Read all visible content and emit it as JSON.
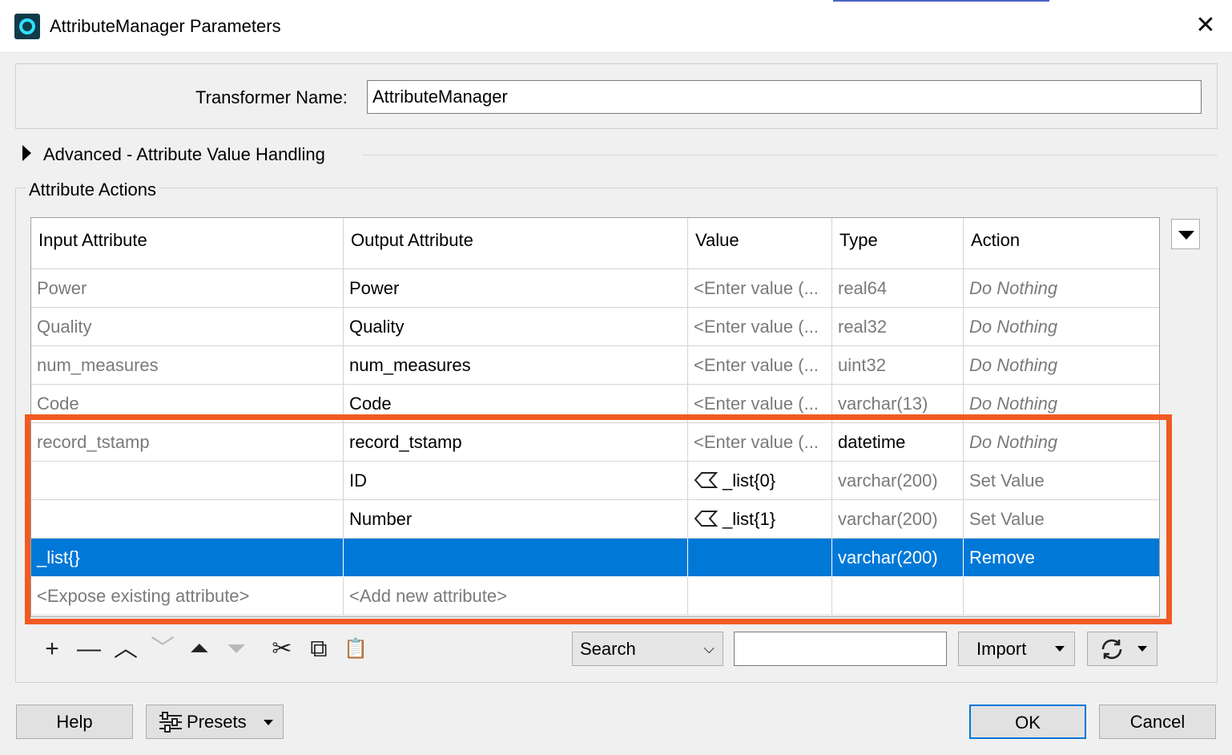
{
  "window": {
    "title": "AttributeManager Parameters",
    "close": "✕"
  },
  "transformer": {
    "label": "Transformer Name:",
    "value": "AttributeManager"
  },
  "advanced": {
    "label": "Advanced - Attribute Value Handling"
  },
  "actions": {
    "title": "Attribute Actions",
    "columns": [
      "Input Attribute",
      "Output Attribute",
      "Value",
      "Type",
      "Action"
    ],
    "rows": [
      {
        "input": "Power",
        "output": "Power",
        "value": "<Enter value (...",
        "type": "real64",
        "action": "Do Nothing"
      },
      {
        "input": "Quality",
        "output": "Quality",
        "value": "<Enter value (...",
        "type": "real32",
        "action": "Do Nothing"
      },
      {
        "input": "num_measures",
        "output": "num_measures",
        "value": "<Enter value (...",
        "type": "uint32",
        "action": "Do Nothing"
      },
      {
        "input": "Code",
        "output": "Code",
        "value": "<Enter value (...",
        "type": "varchar(13)",
        "action": "Do Nothing"
      },
      {
        "input": "record_tstamp",
        "output": "record_tstamp",
        "value": "<Enter value (...",
        "type": "datetime",
        "action": "Do Nothing"
      },
      {
        "input": "",
        "output": "ID",
        "value": "_list{0}",
        "type": "varchar(200)",
        "action": "Set Value"
      },
      {
        "input": "",
        "output": "Number",
        "value": "_list{1}",
        "type": "varchar(200)",
        "action": "Set Value"
      },
      {
        "input": "_list{}",
        "output": "",
        "value": "",
        "type": "varchar(200)",
        "action": "Remove"
      },
      {
        "input": "<Expose existing attribute>",
        "output": "<Add new attribute>",
        "value": "",
        "type": "",
        "action": ""
      }
    ],
    "selected_row": 7
  },
  "toolbar": {
    "add": "+",
    "remove": "—",
    "move_up": "︿",
    "move_down": "﹀",
    "move_top": "⏶",
    "move_bottom": "⏷",
    "cut": "✂",
    "copy": "⧉",
    "paste": "📋",
    "search_select": "Search",
    "search_chevron": "⌵",
    "search_value": "",
    "import_label": "Import"
  },
  "buttons": {
    "help": "Help",
    "presets": "Presets",
    "ok": "OK",
    "cancel": "Cancel"
  },
  "colors": {
    "accent": "#0078d7",
    "highlight": "#f15a22"
  }
}
